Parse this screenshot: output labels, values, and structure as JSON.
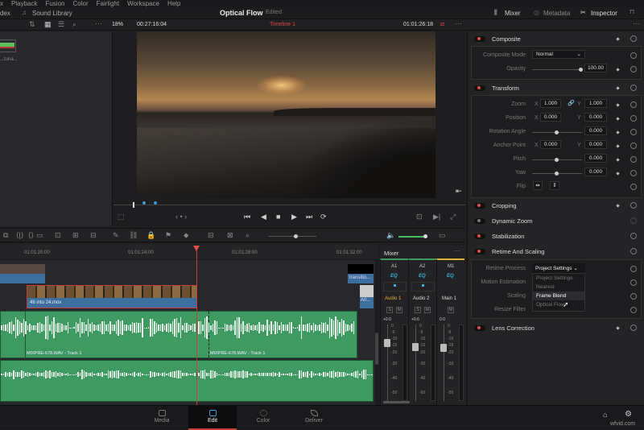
{
  "menu": [
    "x",
    "Playback",
    "Fusion",
    "Color",
    "Fairlight",
    "Workspace",
    "Help"
  ],
  "header": {
    "left_tab": "dex",
    "sound_library": "Sound Library",
    "project_title": "Optical Flow",
    "status": "Edited",
    "mixer": "Mixer",
    "metadata": "Metadata",
    "inspector": "Inspector"
  },
  "toolbar": {
    "zoom": "18%",
    "source_timecode": "00:27:16:04",
    "timeline_name": "Timeline 1",
    "record_timecode": "01:01:26:18"
  },
  "media_pool": {
    "clip_label": "...tuna..."
  },
  "inspector": {
    "composite": {
      "title": "Composite",
      "mode_label": "Composite Mode",
      "mode_value": "Normal",
      "opacity_label": "Opacity",
      "opacity_value": "100.00"
    },
    "transform": {
      "title": "Transform",
      "zoom_label": "Zoom",
      "zoom_x": "1.000",
      "zoom_y": "1.000",
      "position_label": "Position",
      "pos_x": "0.000",
      "pos_y": "0.000",
      "rotation_label": "Rotation Angle",
      "rotation": "0.000",
      "anchor_label": "Anchor Point",
      "anchor_x": "0.000",
      "anchor_y": "0.000",
      "pitch_label": "Pitch",
      "pitch": "0.000",
      "yaw_label": "Yaw",
      "yaw": "0.000",
      "flip_label": "Flip",
      "x": "X",
      "y": "Y"
    },
    "cropping": "Cropping",
    "dynamic_zoom": "Dynamic Zoom",
    "stabilization": "Stabilization",
    "retime": {
      "title": "Retime And Scaling",
      "process_label": "Retime Process",
      "process_value": "Project Settings",
      "motion_label": "Motion Estimation",
      "scaling_label": "Scaling",
      "resize_label": "Resize Filter",
      "options": [
        "Project Settings",
        "Nearest",
        "Frame Blend",
        "Optical Flow"
      ]
    },
    "lens": "Lens Correction"
  },
  "timeline": {
    "ruler": [
      "01:01:20:00",
      "01:01:24:00",
      "01:01:28:00",
      "01:01:32:00"
    ],
    "clip_video": "48 into 24.mov",
    "clip_transition": "transitio...",
    "clip_a0": "A0...",
    "audio_clip_1": "MIXPRE-678.WAV - Track 1",
    "audio_clip_2": "MIXPRE-678.WAV - Track 1"
  },
  "mixer": {
    "title": "Mixer",
    "channels": [
      {
        "id": "A1",
        "name": "Audio 1",
        "level": "+0.0"
      },
      {
        "id": "A2",
        "name": "Audio 2",
        "level": "+0.6"
      },
      {
        "id": "M1",
        "name": "Main 1",
        "level": "0.0"
      }
    ],
    "eq": "EQ",
    "solo": "S",
    "mute": "M",
    "scale": [
      "0",
      "-5",
      "-10",
      "-15",
      "-20",
      "-30",
      "-40",
      "-50"
    ]
  },
  "pages": [
    "Media",
    "Edit",
    "Color",
    "Deliver"
  ],
  "watermark": "wfvid.com",
  "colors": {
    "accent_red": "#e64b4b",
    "audio_green": "#3f9a62",
    "video_blue": "#3d6f9e",
    "active_yellow": "#e0b040"
  }
}
